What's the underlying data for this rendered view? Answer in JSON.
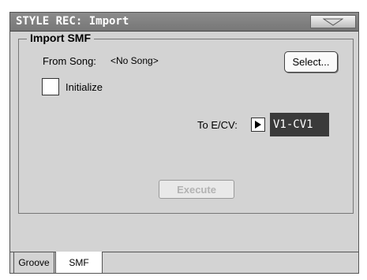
{
  "window": {
    "title": "STYLE REC: Import",
    "menu_icon": "triangle-down-icon"
  },
  "import_group": {
    "title": "Import SMF",
    "from_song_label": "From Song:",
    "from_song_value": "<No Song>",
    "select_button": "Select...",
    "initialize_label": "Initialize",
    "initialize_checked": false,
    "to_ecv_label": "To E/CV:",
    "to_ecv_value": "V1-CV1",
    "execute_button": "Execute"
  },
  "tabs": [
    {
      "label": "Groove",
      "active": false
    },
    {
      "label": "SMF",
      "active": true
    }
  ],
  "colors": {
    "title_bar": "#808080",
    "panel": "#d3d3d3",
    "value_field": "#3a3a3a"
  }
}
